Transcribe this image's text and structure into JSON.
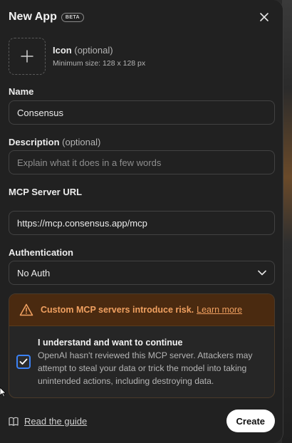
{
  "header": {
    "title": "New App",
    "badge": "BETA"
  },
  "icon": {
    "label": "Icon",
    "optional": "(optional)",
    "hint": "Minimum size: 128 x 128 px"
  },
  "name": {
    "label": "Name",
    "value": "Consensus"
  },
  "description": {
    "label": "Description",
    "optional": "(optional)",
    "placeholder": "Explain what it does in a few words"
  },
  "mcp": {
    "label": "MCP Server URL",
    "value": "https://mcp.consensus.app/mcp"
  },
  "auth": {
    "label": "Authentication",
    "selected": "No Auth"
  },
  "warning": {
    "text": "Custom MCP servers introduce risk.",
    "link": "Learn more",
    "color": "#f0a060"
  },
  "acknowledge": {
    "title": "I understand and want to continue",
    "body": "OpenAI hasn't reviewed this MCP server. Attackers may attempt to steal your data or trick the model into taking unintended actions, including destroying data.",
    "checked": true
  },
  "footer": {
    "guide": "Read the guide",
    "create": "Create"
  },
  "colors": {
    "accent": "#3b82f6",
    "background": "#212121"
  }
}
